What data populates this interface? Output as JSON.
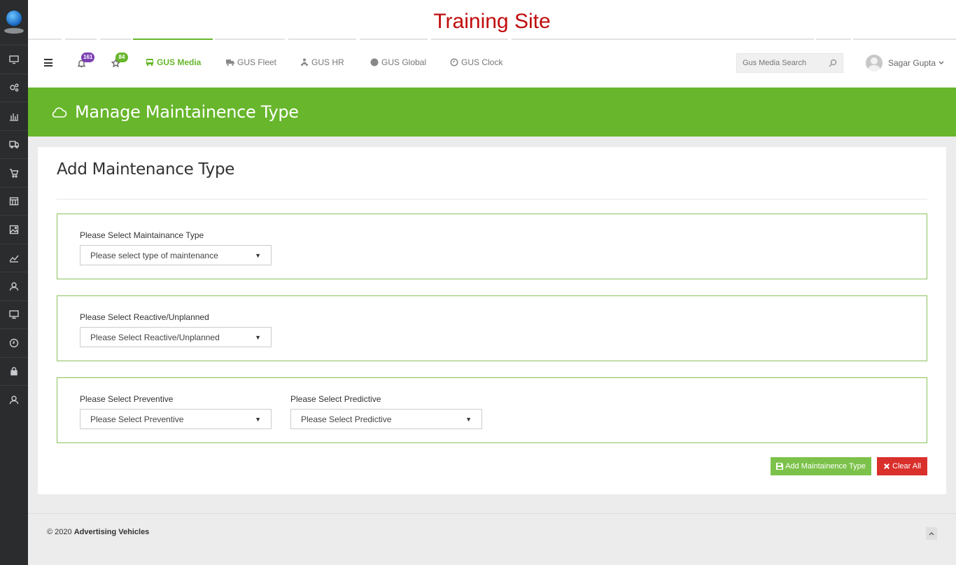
{
  "site": {
    "title": "Training Site"
  },
  "sidebar": {
    "items": [
      {
        "icon": "monitor-icon"
      },
      {
        "icon": "gears-icon"
      },
      {
        "icon": "bar-chart-icon"
      },
      {
        "icon": "truck-icon"
      },
      {
        "icon": "cart-icon"
      },
      {
        "icon": "calendar-icon"
      },
      {
        "icon": "image-icon"
      },
      {
        "icon": "line-chart-icon"
      },
      {
        "icon": "user-icon"
      },
      {
        "icon": "desktop-icon"
      },
      {
        "icon": "clock-icon"
      },
      {
        "icon": "lock-icon"
      },
      {
        "icon": "user-icon"
      }
    ]
  },
  "nav": {
    "notifications_count": "161",
    "favorites_count": "84",
    "links": [
      {
        "label": "GUS Media",
        "icon": "bus-icon",
        "active": true
      },
      {
        "label": "GUS Fleet",
        "icon": "truck-icon",
        "active": false
      },
      {
        "label": "GUS HR",
        "icon": "people-icon",
        "active": false
      },
      {
        "label": "GUS Global",
        "icon": "globe-icon",
        "active": false
      },
      {
        "label": "GUS Clock",
        "icon": "clock-icon",
        "active": false
      }
    ],
    "search_placeholder": "Gus Media Search",
    "user_name": "Sagar Gupta"
  },
  "page": {
    "header": "Manage Maintainence Type",
    "card_title": "Add Maintenance Type",
    "fields": {
      "maintenance_type": {
        "label": "Please Select Maintainance Type",
        "value": "Please select type of maintenance"
      },
      "reactive": {
        "label": "Please Select Reactive/Unplanned",
        "value": "Please Select Reactive/Unplanned"
      },
      "preventive": {
        "label": "Please Select Preventive",
        "value": "Please Select Preventive"
      },
      "predictive": {
        "label": "Please Select Predictive",
        "value": "Please Select Predictive"
      }
    },
    "buttons": {
      "add": "Add Maintainence Type",
      "clear": "Clear All"
    }
  },
  "footer": {
    "copyright": "© 2020",
    "company": "Advertising Vehicles"
  },
  "colors": {
    "brand_green": "#67b62b",
    "title_red": "#c00d0d",
    "danger": "#d9302c",
    "sidebar": "#2b2c2e"
  }
}
